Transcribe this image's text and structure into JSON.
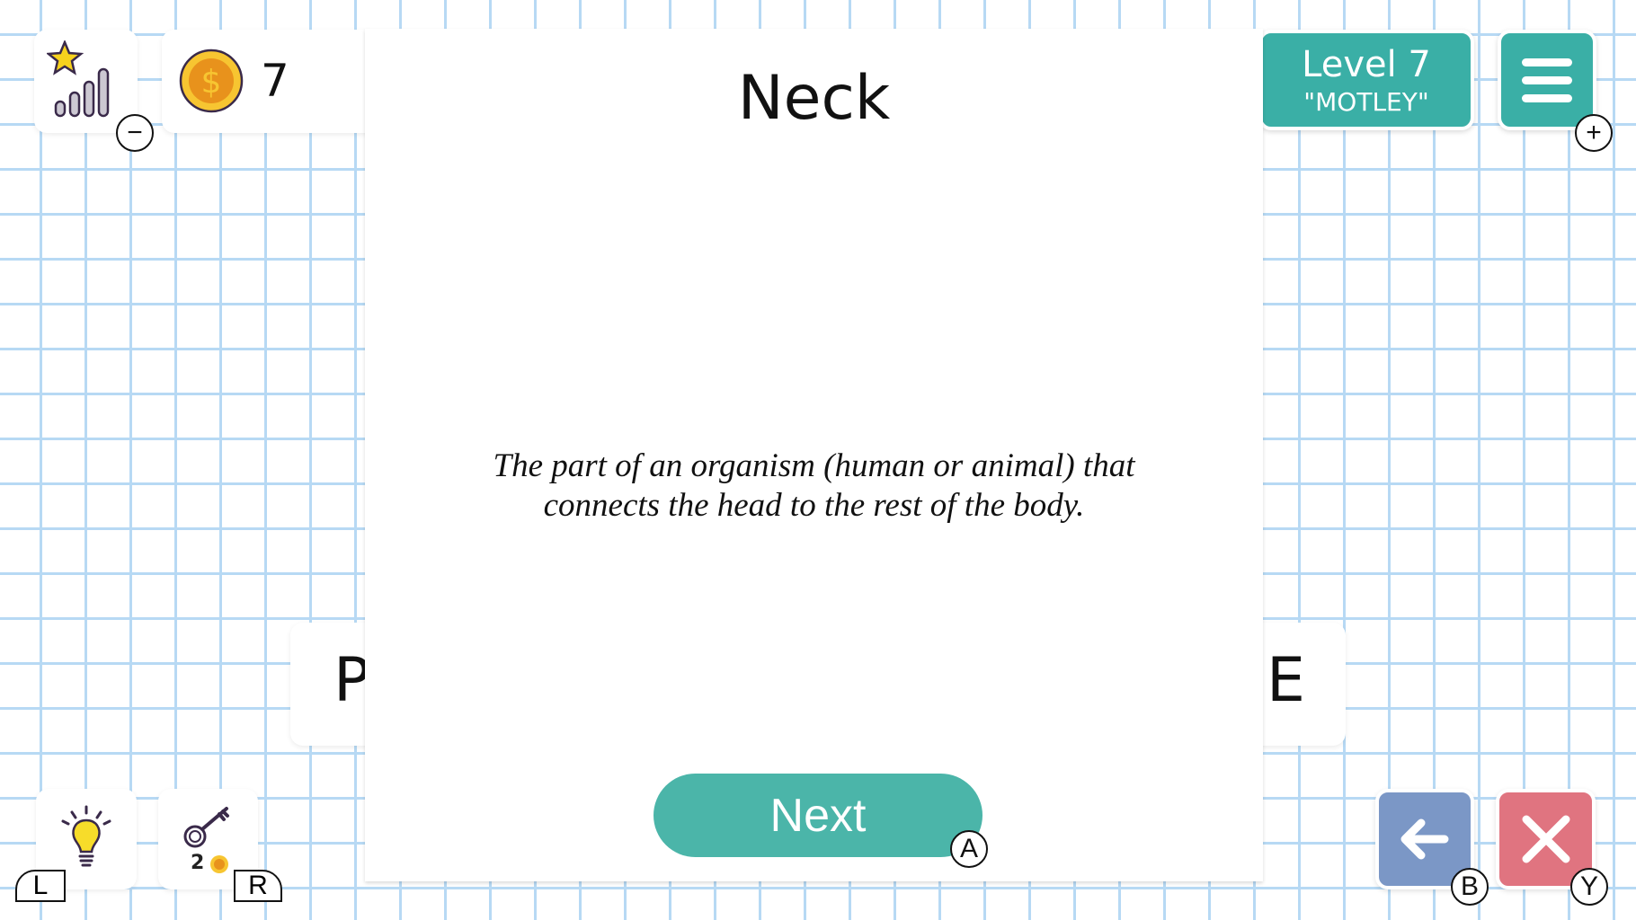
{
  "stats": {
    "icon": "star-stats-icon",
    "zoom_out_key": "−"
  },
  "coins": {
    "icon": "coin-icon",
    "count": "7"
  },
  "level": {
    "title": "Level 7",
    "name": "\"MOTLEY\""
  },
  "menu": {
    "icon": "hamburger-menu-icon",
    "zoom_in_key": "+"
  },
  "card": {
    "word": "Neck",
    "definition_line1": "The part of an organism (human or animal) that",
    "definition_line2": "connects the head to the rest of the body.",
    "next_label": "Next",
    "next_key": "A"
  },
  "tiles": {
    "left_letter": "P",
    "right_letter": "E"
  },
  "hint": {
    "icon": "lightbulb-icon",
    "key": "L"
  },
  "key_hint": {
    "icon": "key-icon",
    "cost": "2",
    "cost_icon": "coin-icon",
    "key": "R"
  },
  "back": {
    "icon": "arrow-left-icon",
    "key": "B",
    "color": "#7b97c6"
  },
  "close": {
    "icon": "close-icon",
    "key": "Y",
    "color": "#e07480"
  },
  "colors": {
    "teal": "#3aafa6",
    "grid": "#b7d9f4"
  }
}
